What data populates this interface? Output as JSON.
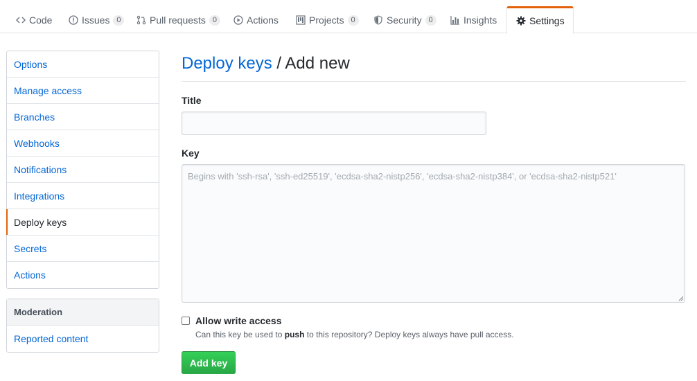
{
  "repo_nav": {
    "tabs": [
      {
        "label": "Code",
        "icon": "code-icon",
        "counter": null
      },
      {
        "label": "Issues",
        "icon": "issue-icon",
        "counter": "0"
      },
      {
        "label": "Pull requests",
        "icon": "pull-request-icon",
        "counter": "0"
      },
      {
        "label": "Actions",
        "icon": "play-icon",
        "counter": null
      },
      {
        "label": "Projects",
        "icon": "project-icon",
        "counter": "0"
      },
      {
        "label": "Security",
        "icon": "shield-icon",
        "counter": "0"
      },
      {
        "label": "Insights",
        "icon": "graph-icon",
        "counter": null
      },
      {
        "label": "Settings",
        "icon": "gear-icon",
        "counter": null,
        "selected": true
      }
    ]
  },
  "sidebar": {
    "items": [
      {
        "label": "Options"
      },
      {
        "label": "Manage access"
      },
      {
        "label": "Branches"
      },
      {
        "label": "Webhooks"
      },
      {
        "label": "Notifications"
      },
      {
        "label": "Integrations"
      },
      {
        "label": "Deploy keys",
        "selected": true
      },
      {
        "label": "Secrets"
      },
      {
        "label": "Actions"
      }
    ],
    "moderation": {
      "heading": "Moderation",
      "items": [
        {
          "label": "Reported content"
        }
      ]
    }
  },
  "main": {
    "heading_link": "Deploy keys",
    "heading_rest": " / Add new",
    "title_label": "Title",
    "title_value": "",
    "key_label": "Key",
    "key_placeholder": "Begins with 'ssh-rsa', 'ssh-ed25519', 'ecdsa-sha2-nistp256', 'ecdsa-sha2-nistp384', or 'ecdsa-sha2-nistp521'",
    "allow_write_label": "Allow write access",
    "allow_write_checked": false,
    "note_before": "Can this key be used to ",
    "note_bold": "push",
    "note_after": " to this repository? Deploy keys always have pull access.",
    "add_button": "Add key"
  },
  "colors": {
    "link": "#0366d6",
    "selected_accent": "#e36209",
    "button_green": "#28a745"
  }
}
